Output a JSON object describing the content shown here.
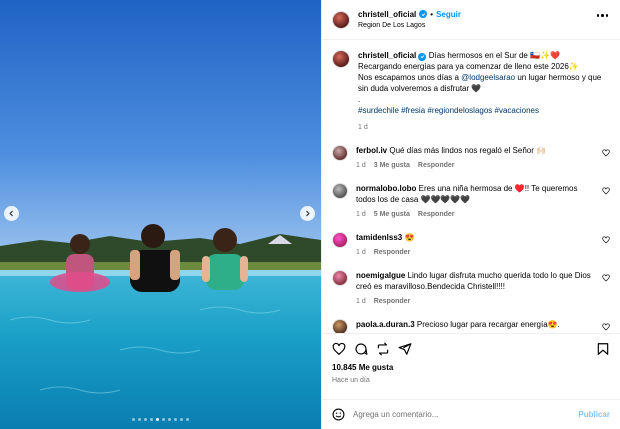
{
  "header": {
    "username": "christell_oficial",
    "follow_label": "Seguir",
    "bullet": "•",
    "location": "Region De Los Lagos"
  },
  "caption": {
    "username": "christell_oficial",
    "line1": "Días hermosos en el Sur de 🇨🇱✨❤️",
    "line2": "Recargando energías para ya comenzar de lleno este 2026✨",
    "line3_prefix": "Nos escapamos unos días a ",
    "mention": "@lodgeelsarao",
    "line3_suffix": " un lugar hermoso y que sin duda volveremos a disfrutar 🖤",
    "dot": ".",
    "hashtags": "#surdechile #fresia #regiondeloslagos #vacaciones",
    "age": "1 d"
  },
  "comments": [
    {
      "username": "ferbol.iv",
      "text": "Qué días más lindos nos regaló el Señor 🙌🏻",
      "age": "1 d",
      "likes": "3 Me gusta",
      "reply": "Responder"
    },
    {
      "username": "normalobo.lobo",
      "text": "Eres una niña hermosa de ♥️!! Te queremos todos los de casa 🖤🖤🖤🖤🖤",
      "age": "1 d",
      "likes": "5 Me gusta",
      "reply": "Responder"
    },
    {
      "username": "tamidenlss3",
      "text": "😍",
      "age": "1 d",
      "likes": "",
      "reply": "Responder"
    },
    {
      "username": "noemigalgue",
      "text": "Lindo lugar disfruta mucho querida todo lo que Dios creó es maravilloso.Bendecida Christell!!!!",
      "age": "1 d",
      "likes": "",
      "reply": "Responder"
    },
    {
      "username": "paola.a.duran.3",
      "text": "Precioso lugar para recargar energía😍.",
      "age": "",
      "likes": "",
      "reply": ""
    }
  ],
  "likes_count": "10.845 Me gusta",
  "posted": "Hace un día",
  "add_comment": {
    "placeholder": "Agrega un comentario...",
    "publish": "Publicar"
  },
  "carousel": {
    "total": 10,
    "active_index": 4
  },
  "icons": [
    "chevron-left-icon",
    "chevron-right-icon",
    "more-icon",
    "verified-icon",
    "heart-icon",
    "comment-icon",
    "repost-icon",
    "share-icon",
    "bookmark-icon",
    "emoji-icon"
  ]
}
